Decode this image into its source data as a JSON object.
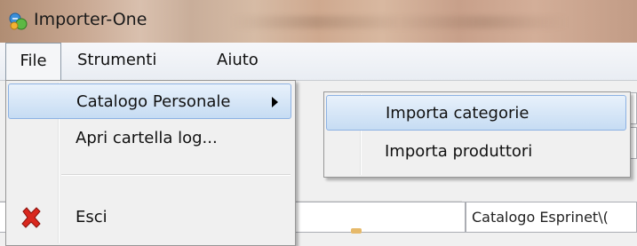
{
  "window": {
    "title": "Importer-One",
    "icon": "importer-app-icon"
  },
  "menubar": {
    "items": [
      {
        "label": "File"
      },
      {
        "label": "Strumenti"
      },
      {
        "label": "Aiuto"
      }
    ]
  },
  "file_menu": {
    "items": [
      {
        "label": "Catalogo Personale",
        "has_submenu": true,
        "highlighted": true
      },
      {
        "label": "Apri cartella log..."
      },
      {
        "label": "Esci",
        "icon": "red-x-icon"
      }
    ]
  },
  "submenu": {
    "items": [
      {
        "label": "Importa categorie",
        "highlighted": true
      },
      {
        "label": "Importa produttori"
      }
    ]
  },
  "background": {
    "path_field_value": "Catalogo Esprinet\\("
  },
  "colors": {
    "highlight_border": "#8db2e3",
    "highlight_fill": "#c6dcf3",
    "exit_icon": "#d9281e"
  }
}
